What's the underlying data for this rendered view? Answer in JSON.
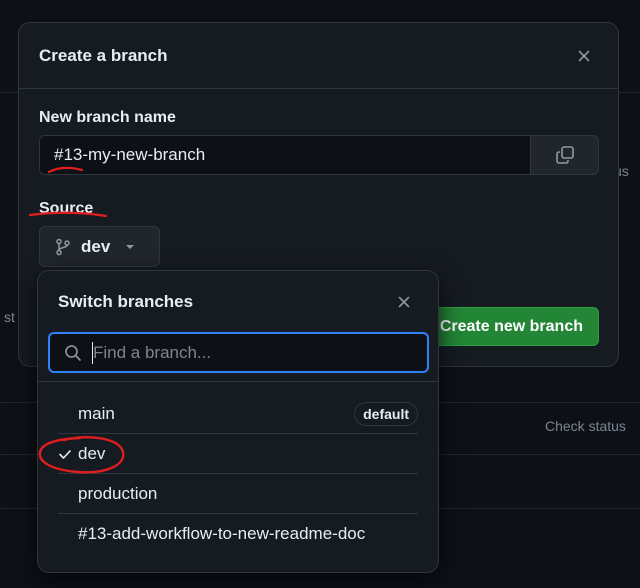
{
  "background": {
    "status_text_1": "us",
    "status_text_2": "st",
    "check_status": "Check status"
  },
  "dialog": {
    "title": "Create a branch",
    "new_branch_label": "New branch name",
    "branch_name_value": "#13-my-new-branch",
    "source_label": "Source",
    "source_branch": "dev",
    "create_button": "Create new branch"
  },
  "switcher": {
    "title": "Switch branches",
    "search_placeholder": "Find a branch...",
    "branches": [
      {
        "name": "main",
        "badge": "default",
        "selected": false
      },
      {
        "name": "dev",
        "badge": "",
        "selected": true
      },
      {
        "name": "production",
        "badge": "",
        "selected": false
      },
      {
        "name": "#13-add-workflow-to-new-readme-doc",
        "badge": "",
        "selected": false
      }
    ]
  },
  "colors": {
    "accent_blue": "#2f81f7",
    "create_green": "#238636",
    "annotation_red": "#e01e1e"
  },
  "icons": [
    "close-icon",
    "copy-icon",
    "git-branch-icon",
    "triangle-down-icon",
    "search-icon",
    "check-icon"
  ]
}
